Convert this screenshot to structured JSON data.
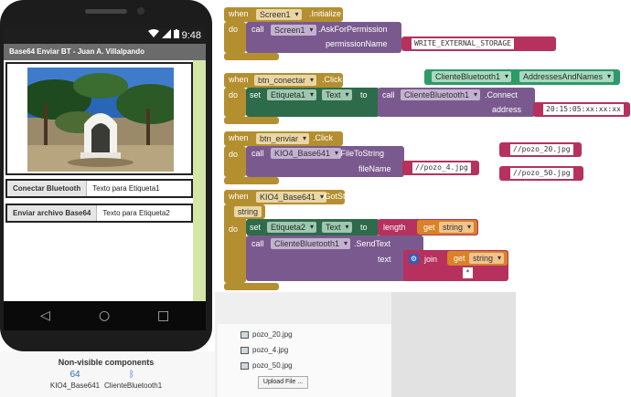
{
  "phone": {
    "status_time": "9:48",
    "app_title": "Base64 Enviar BT - Juan A. Villalpando",
    "button_connect": "Conectar Bluetooth",
    "label1": "Texto para Etiqueta1",
    "button_send": "Enviar archivo Base64",
    "label2": "Texto para Etiqueta2"
  },
  "non_visible": {
    "title": "Non-visible components",
    "components": [
      {
        "name": "KIO4_Base641",
        "icon": "64"
      },
      {
        "name": "ClienteBluetooth1",
        "icon": "bluetooth-icon"
      }
    ]
  },
  "media": {
    "files": [
      "pozo_20.jpg",
      "pozo_4.jpg",
      "pozo_50.jpg"
    ],
    "upload_label": "Upload File ..."
  },
  "blocks": {
    "init": {
      "when": "when",
      "component": "Screen1",
      "event": ".Initialize",
      "do": "do",
      "call": "call",
      "call_component": "Screen1",
      "method": ".AskForPermission",
      "arg_label": "permissionName",
      "arg_value": "WRITE_EXTERNAL_STORAGE"
    },
    "connect": {
      "when": "when",
      "component": "btn_conectar",
      "event": ".Click",
      "do": "do",
      "set": "set",
      "set_component": "Etiqueta1",
      "property": "Text",
      "to": "to",
      "call": "call",
      "call_component": "ClienteBluetooth1",
      "method": ".Connect",
      "arg_label": "address",
      "arg_value": "20:15:05:xx:xx:xx"
    },
    "loose_addresses": {
      "component": "ClienteBluetooth1",
      "property": "AddressesAndNames"
    },
    "send": {
      "when": "when",
      "component": "btn_enviar",
      "event": ".Click",
      "do": "do",
      "call": "call",
      "call_component": "KIO4_Base641",
      "method": ".FileToString",
      "arg_label": "fileName",
      "arg_value": "//pozo_4.jpg"
    },
    "loose_strings": [
      "//pozo_20.jpg",
      "//pozo_50.jpg"
    ],
    "got": {
      "when": "when",
      "component": "KIO4_Base641",
      "event": ".GotString",
      "param": "string",
      "do": "do",
      "set": "set",
      "set_component": "Etiqueta2",
      "property": "Text",
      "to": "to",
      "length": "length",
      "get": "get",
      "get_var": "string",
      "call": "call",
      "call_component": "ClienteBluetooth1",
      "method": ".SendText",
      "arg_label": "text",
      "join": "join",
      "get2": "get",
      "get2_var": "string",
      "str_value": "*"
    }
  },
  "colors": {
    "event": "#b48f30",
    "procedure": "#7a5a8e",
    "setter": "#2d6b4a",
    "getter": "#d98226",
    "text": "#b6315d",
    "component": "#2e9a68"
  }
}
